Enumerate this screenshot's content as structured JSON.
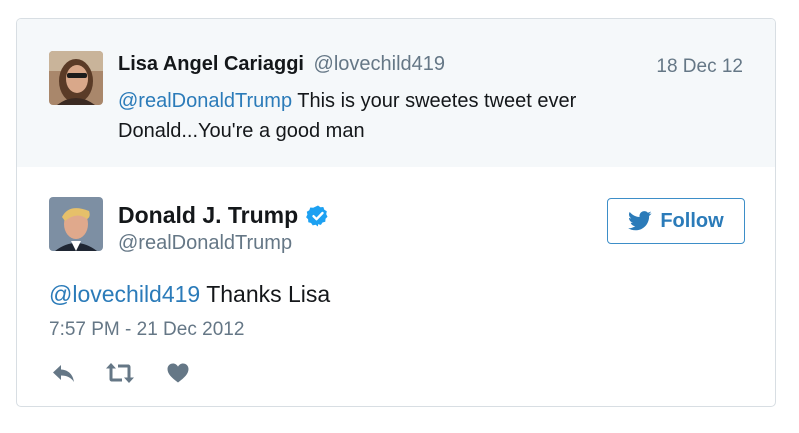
{
  "parent_tweet": {
    "author_name": "Lisa Angel Cariaggi",
    "author_handle": "@lovechild419",
    "date": "18 Dec 12",
    "mention": "@realDonaldTrump",
    "text_line1": " This is your sweetes tweet ever",
    "text_line2": "Donald...You're a good man",
    "avatar_icon": "user-avatar-photo"
  },
  "main_tweet": {
    "author_name": "Donald J. Trump",
    "author_handle": "@realDonaldTrump",
    "verified_icon": "verified-badge-icon",
    "follow_label": "Follow",
    "mention": "@lovechild419",
    "text": " Thanks Lisa",
    "timestamp": "7:57 PM - 21 Dec 2012",
    "actions": [
      "reply-icon",
      "retweet-icon",
      "like-icon"
    ]
  },
  "colors": {
    "link": "#2b7bb9",
    "muted": "#657786",
    "text": "#14171a",
    "parent_bg": "#f5f8fa",
    "verified": "#1da1f2",
    "icon": "#657786"
  }
}
